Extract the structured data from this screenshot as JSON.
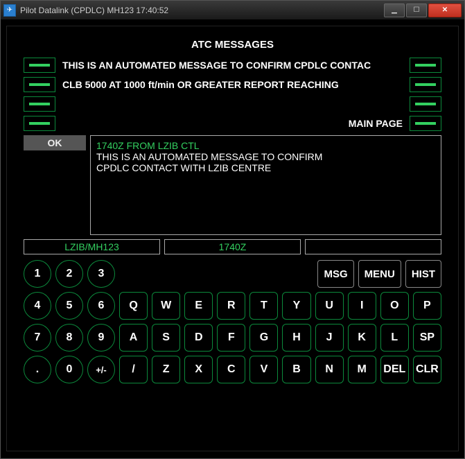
{
  "window": {
    "title": "Pilot Datalink (CPDLC) MH123    17:40:52"
  },
  "header": "ATC MESSAGES",
  "rows": {
    "r1": "THIS IS AN AUTOMATED MESSAGE TO CONFIRM CPDLC CONTAC",
    "r2": "CLB 5000 AT 1000 ft/min OR GREATER REPORT REACHING",
    "r4_right": "MAIN PAGE"
  },
  "ok_label": "OK",
  "message": {
    "header": "1740Z FROM LZIB CTL",
    "line1": "THIS IS AN AUTOMATED MESSAGE TO CONFIRM",
    "line2": "CPDLC CONTACT WITH LZIB CENTRE"
  },
  "status": {
    "box1": "LZIB/MH123",
    "box2": "1740Z",
    "box3": ""
  },
  "func": {
    "msg": "MSG",
    "menu": "MENU",
    "hist": "HIST"
  },
  "keys": {
    "n1": "1",
    "n2": "2",
    "n3": "3",
    "n4": "4",
    "n5": "5",
    "n6": "6",
    "n7": "7",
    "n8": "8",
    "n9": "9",
    "n0": "0",
    "dot": ".",
    "pm": "+/-",
    "q": "Q",
    "w": "W",
    "e": "E",
    "r": "R",
    "t": "T",
    "y": "Y",
    "u": "U",
    "i": "I",
    "o": "O",
    "p": "P",
    "a": "A",
    "s": "S",
    "d": "D",
    "f": "F",
    "g": "G",
    "h": "H",
    "j": "J",
    "k": "K",
    "l": "L",
    "sp": "SP",
    "sl": "/",
    "z": "Z",
    "x": "X",
    "c": "C",
    "v": "V",
    "b": "B",
    "n": "N",
    "m": "M",
    "del": "DEL",
    "clr": "CLR"
  }
}
